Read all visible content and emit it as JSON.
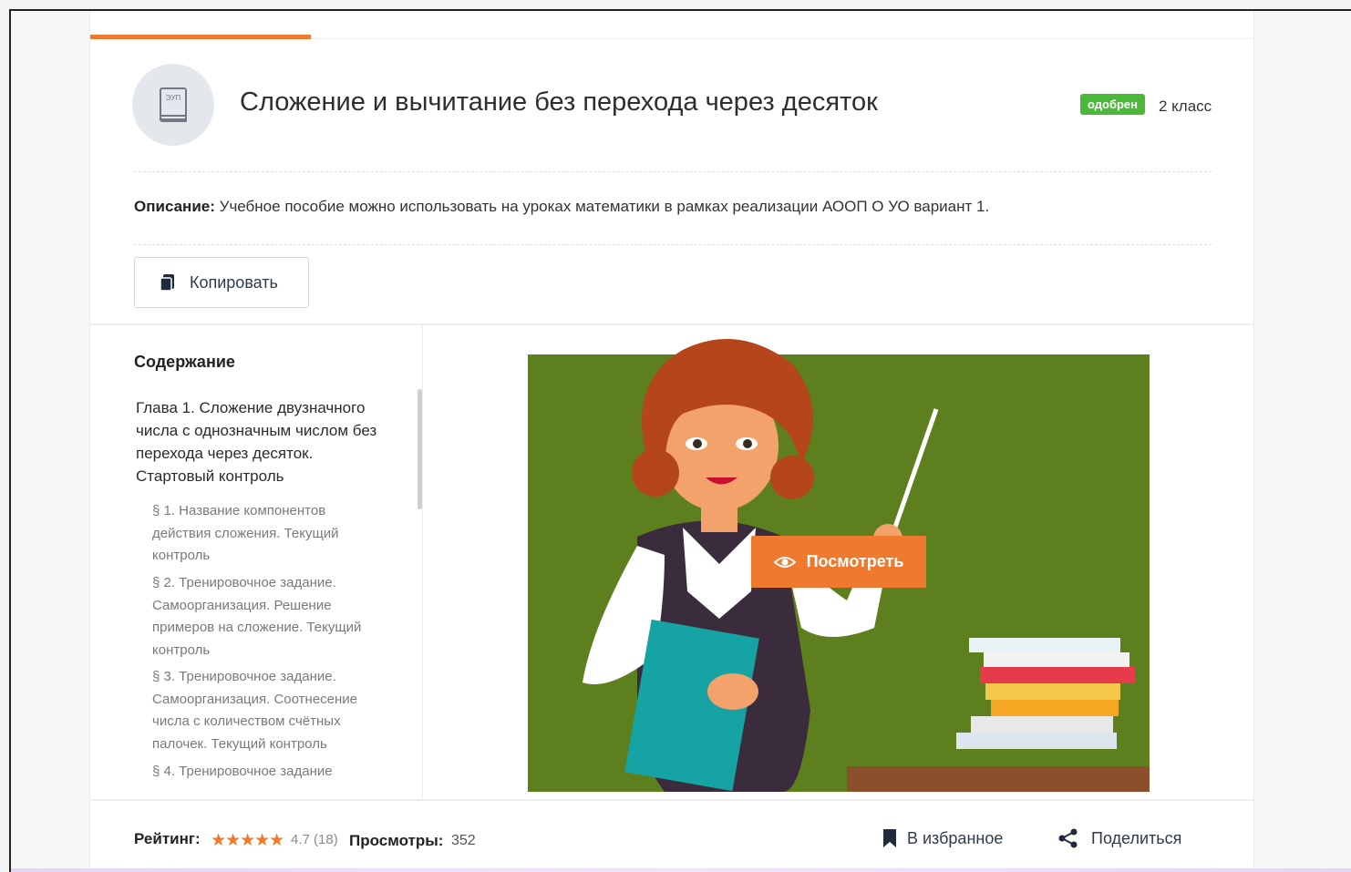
{
  "header": {
    "title": "Сложение и вычитание без перехода через десяток",
    "badge": "одобрен",
    "grade": "2 класс",
    "book_icon_label": "ЭУП"
  },
  "description": {
    "label": "Описание:",
    "text": "Учебное пособие можно использовать на уроках математики в рамках реализации АООП О УО вариант 1."
  },
  "copy_button": {
    "label": "Копировать"
  },
  "toc": {
    "heading": "Содержание",
    "chapter": "Глава 1. Сложение двузначного числа с однозначным числом без перехода через десяток. Стартовый контроль",
    "items": [
      "§ 1. Название компонентов действия сложения. Текущий контроль",
      "§ 2. Тренировочное задание. Самоорганизация. Решение примеров на сложение. Текущий контроль",
      "§ 3. Тренировочное задание. Самоорганизация. Соотнесение числа с количеством счётных палочек. Текущий контроль",
      "§ 4. Тренировочное задание"
    ]
  },
  "preview": {
    "view_button": "Посмотреть"
  },
  "footer": {
    "rating_label": "Рейтинг:",
    "stars": "★★★★★",
    "rating_value": "4.7 (18)",
    "views_label": "Просмотры:",
    "views_value": "352",
    "favorite": "В избранное",
    "share": "Поделиться"
  },
  "colors": {
    "accent": "#ef7a2f",
    "approved": "#4cb83a",
    "board": "#5e7f1d"
  }
}
